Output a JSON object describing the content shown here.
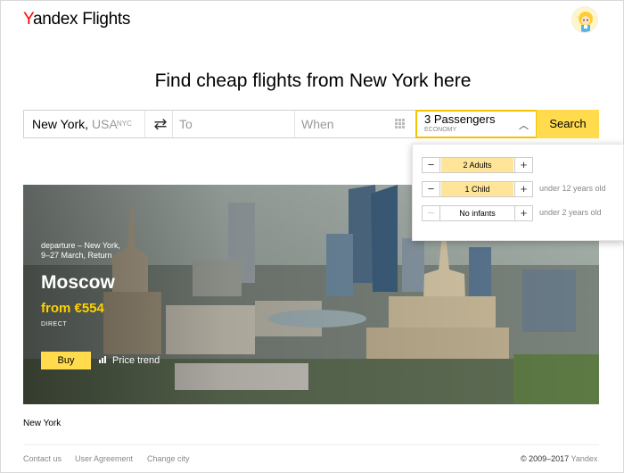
{
  "header": {
    "logo_brand": "Yandex",
    "logo_product": "Flights"
  },
  "headline": "Find cheap flights from New York here",
  "search": {
    "from_value": "New York, ",
    "from_value_suffix": "USA",
    "from_code": "NYC",
    "to_placeholder": "To",
    "when_placeholder": "When",
    "passengers_label": "3 Passengers",
    "class_label": "ECONOMY",
    "search_button": "Search"
  },
  "passengers_dropdown": {
    "rows": [
      {
        "value": "2 Adults",
        "note": "",
        "minus": "−",
        "plus": "+"
      },
      {
        "value": "1 Child",
        "note": "under 12 years old",
        "minus": "−",
        "plus": "+"
      },
      {
        "value": "No infants",
        "note": "under 2 years old",
        "minus": "−",
        "plus": "+"
      }
    ]
  },
  "offer": {
    "departure_line1": "departure – New York,",
    "departure_line2": "9–27 March, Return",
    "city": "Moscow",
    "price": "from €554",
    "direct": "DIRECT",
    "buy_button": "Buy",
    "trend_button": "Price trend"
  },
  "origin_city": "New York",
  "footer": {
    "links": [
      "Contact us",
      "User Agreement",
      "Change city"
    ],
    "copyright": "© 2009–2017",
    "brand": "Yandex"
  },
  "colors": {
    "accent": "#ffdb4d",
    "brand_red": "#ff0000",
    "price_yellow": "#ffd200"
  }
}
